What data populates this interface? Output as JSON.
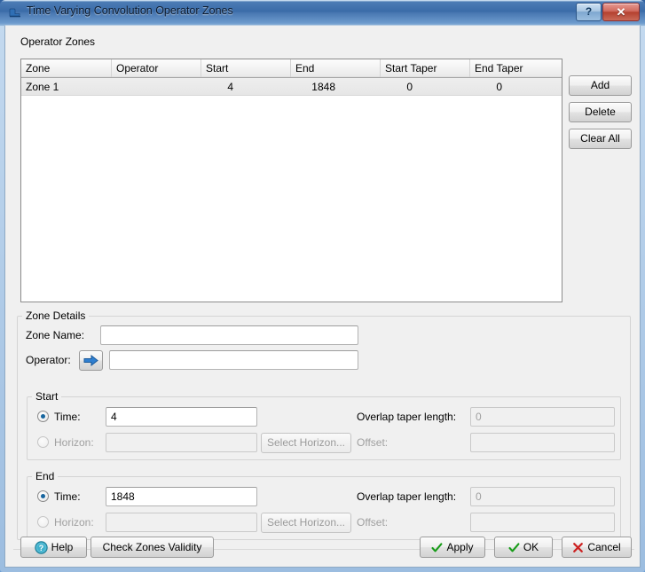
{
  "window": {
    "title": "Time Varying Convolution Operator Zones",
    "icon": "app-window-icon",
    "help_button": "?",
    "close_button": "✕"
  },
  "operator_zones": {
    "group_label": "Operator Zones",
    "columns": [
      "Zone",
      "Operator",
      "Start",
      "End",
      "Start Taper",
      "End Taper"
    ],
    "rows": [
      {
        "zone": "Zone 1",
        "operator": "",
        "start": "4",
        "end": "1848",
        "start_taper": "0",
        "end_taper": "0"
      }
    ],
    "side_buttons": [
      {
        "label": "Add",
        "name": "add-button",
        "enabled": true
      },
      {
        "label": "Delete",
        "name": "delete-button",
        "enabled": true
      },
      {
        "label": "Clear All",
        "name": "clear-all-button",
        "enabled": true
      }
    ]
  },
  "zone_details": {
    "group_label": "Zone Details",
    "zone_name": {
      "label": "Zone Name:",
      "value": ""
    },
    "operator": {
      "label": "Operator:",
      "value": "",
      "browse_icon": "blue-right-arrow-icon"
    },
    "start": {
      "group_label": "Start",
      "time": {
        "label": "Time:",
        "value": "4",
        "selected": true
      },
      "horizon": {
        "label": "Horizon:",
        "value": "",
        "selected": false,
        "enabled": false
      },
      "select_horizon_button": "Select Horizon...",
      "overlap_taper_length": {
        "label": "Overlap taper length:",
        "value": "0",
        "enabled": false
      },
      "offset": {
        "label": "Offset:",
        "value": "",
        "enabled": false
      }
    },
    "end": {
      "group_label": "End",
      "time": {
        "label": "Time:",
        "value": "1848",
        "selected": true
      },
      "horizon": {
        "label": "Horizon:",
        "value": "",
        "selected": false,
        "enabled": false
      },
      "select_horizon_button": "Select Horizon...",
      "overlap_taper_length": {
        "label": "Overlap taper length:",
        "value": "0",
        "enabled": false
      },
      "offset": {
        "label": "Offset:",
        "value": "",
        "enabled": false
      }
    }
  },
  "footer": {
    "help": {
      "label": "Help",
      "icon": "question-circle-icon"
    },
    "check_validity": {
      "label": "Check Zones Validity"
    },
    "apply": {
      "label": "Apply",
      "icon": "green-check-icon"
    },
    "ok": {
      "label": "OK",
      "icon": "green-check-icon"
    },
    "cancel": {
      "label": "Cancel",
      "icon": "red-x-icon"
    }
  },
  "colors": {
    "accent_blue": "#17659e",
    "titlebar_blue": "#3a6ba8",
    "close_red": "#b4402f",
    "check_green": "#189c19",
    "cancel_red": "#cc2222",
    "help_teal": "#2fa8c4",
    "disabled_text": "#a0a0a0"
  }
}
